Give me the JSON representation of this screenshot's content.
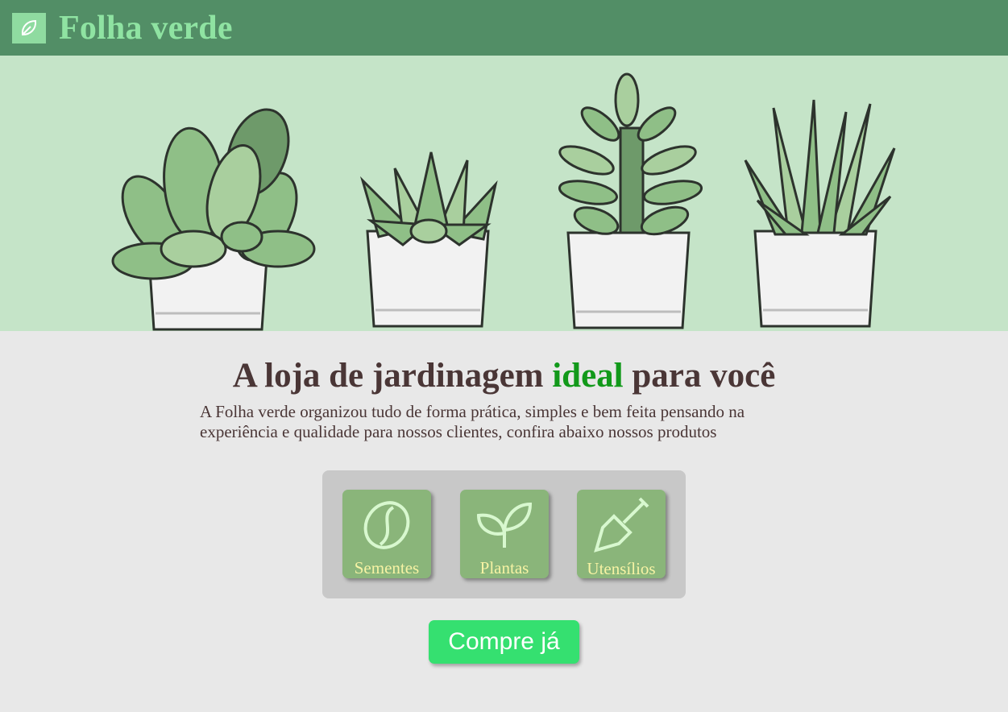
{
  "header": {
    "brand": "Folha verde",
    "logo_icon": "leaf-icon"
  },
  "hero": {
    "illustration": "four potted succulents"
  },
  "headline": {
    "before": "A loja de jardinagem ",
    "accent": "ideal",
    "after": " para você"
  },
  "intro": "A Folha verde organizou tudo de forma prática, simples e bem feita pensando na experiência e qualidade para nossos clientes, confira abaixo nossos produtos",
  "categories": [
    {
      "label": "Sementes",
      "icon": "seed-icon"
    },
    {
      "label": "Plantas",
      "icon": "sprout-icon"
    },
    {
      "label": "Utensílios",
      "icon": "shovel-icon"
    }
  ],
  "cta": {
    "label": "Compre já"
  },
  "colors": {
    "header": "#528e66",
    "brand": "#8fe3a2",
    "accent": "#12991a",
    "card": "#8ab57a",
    "card_text": "#f7f3a4",
    "button": "#35e070"
  }
}
